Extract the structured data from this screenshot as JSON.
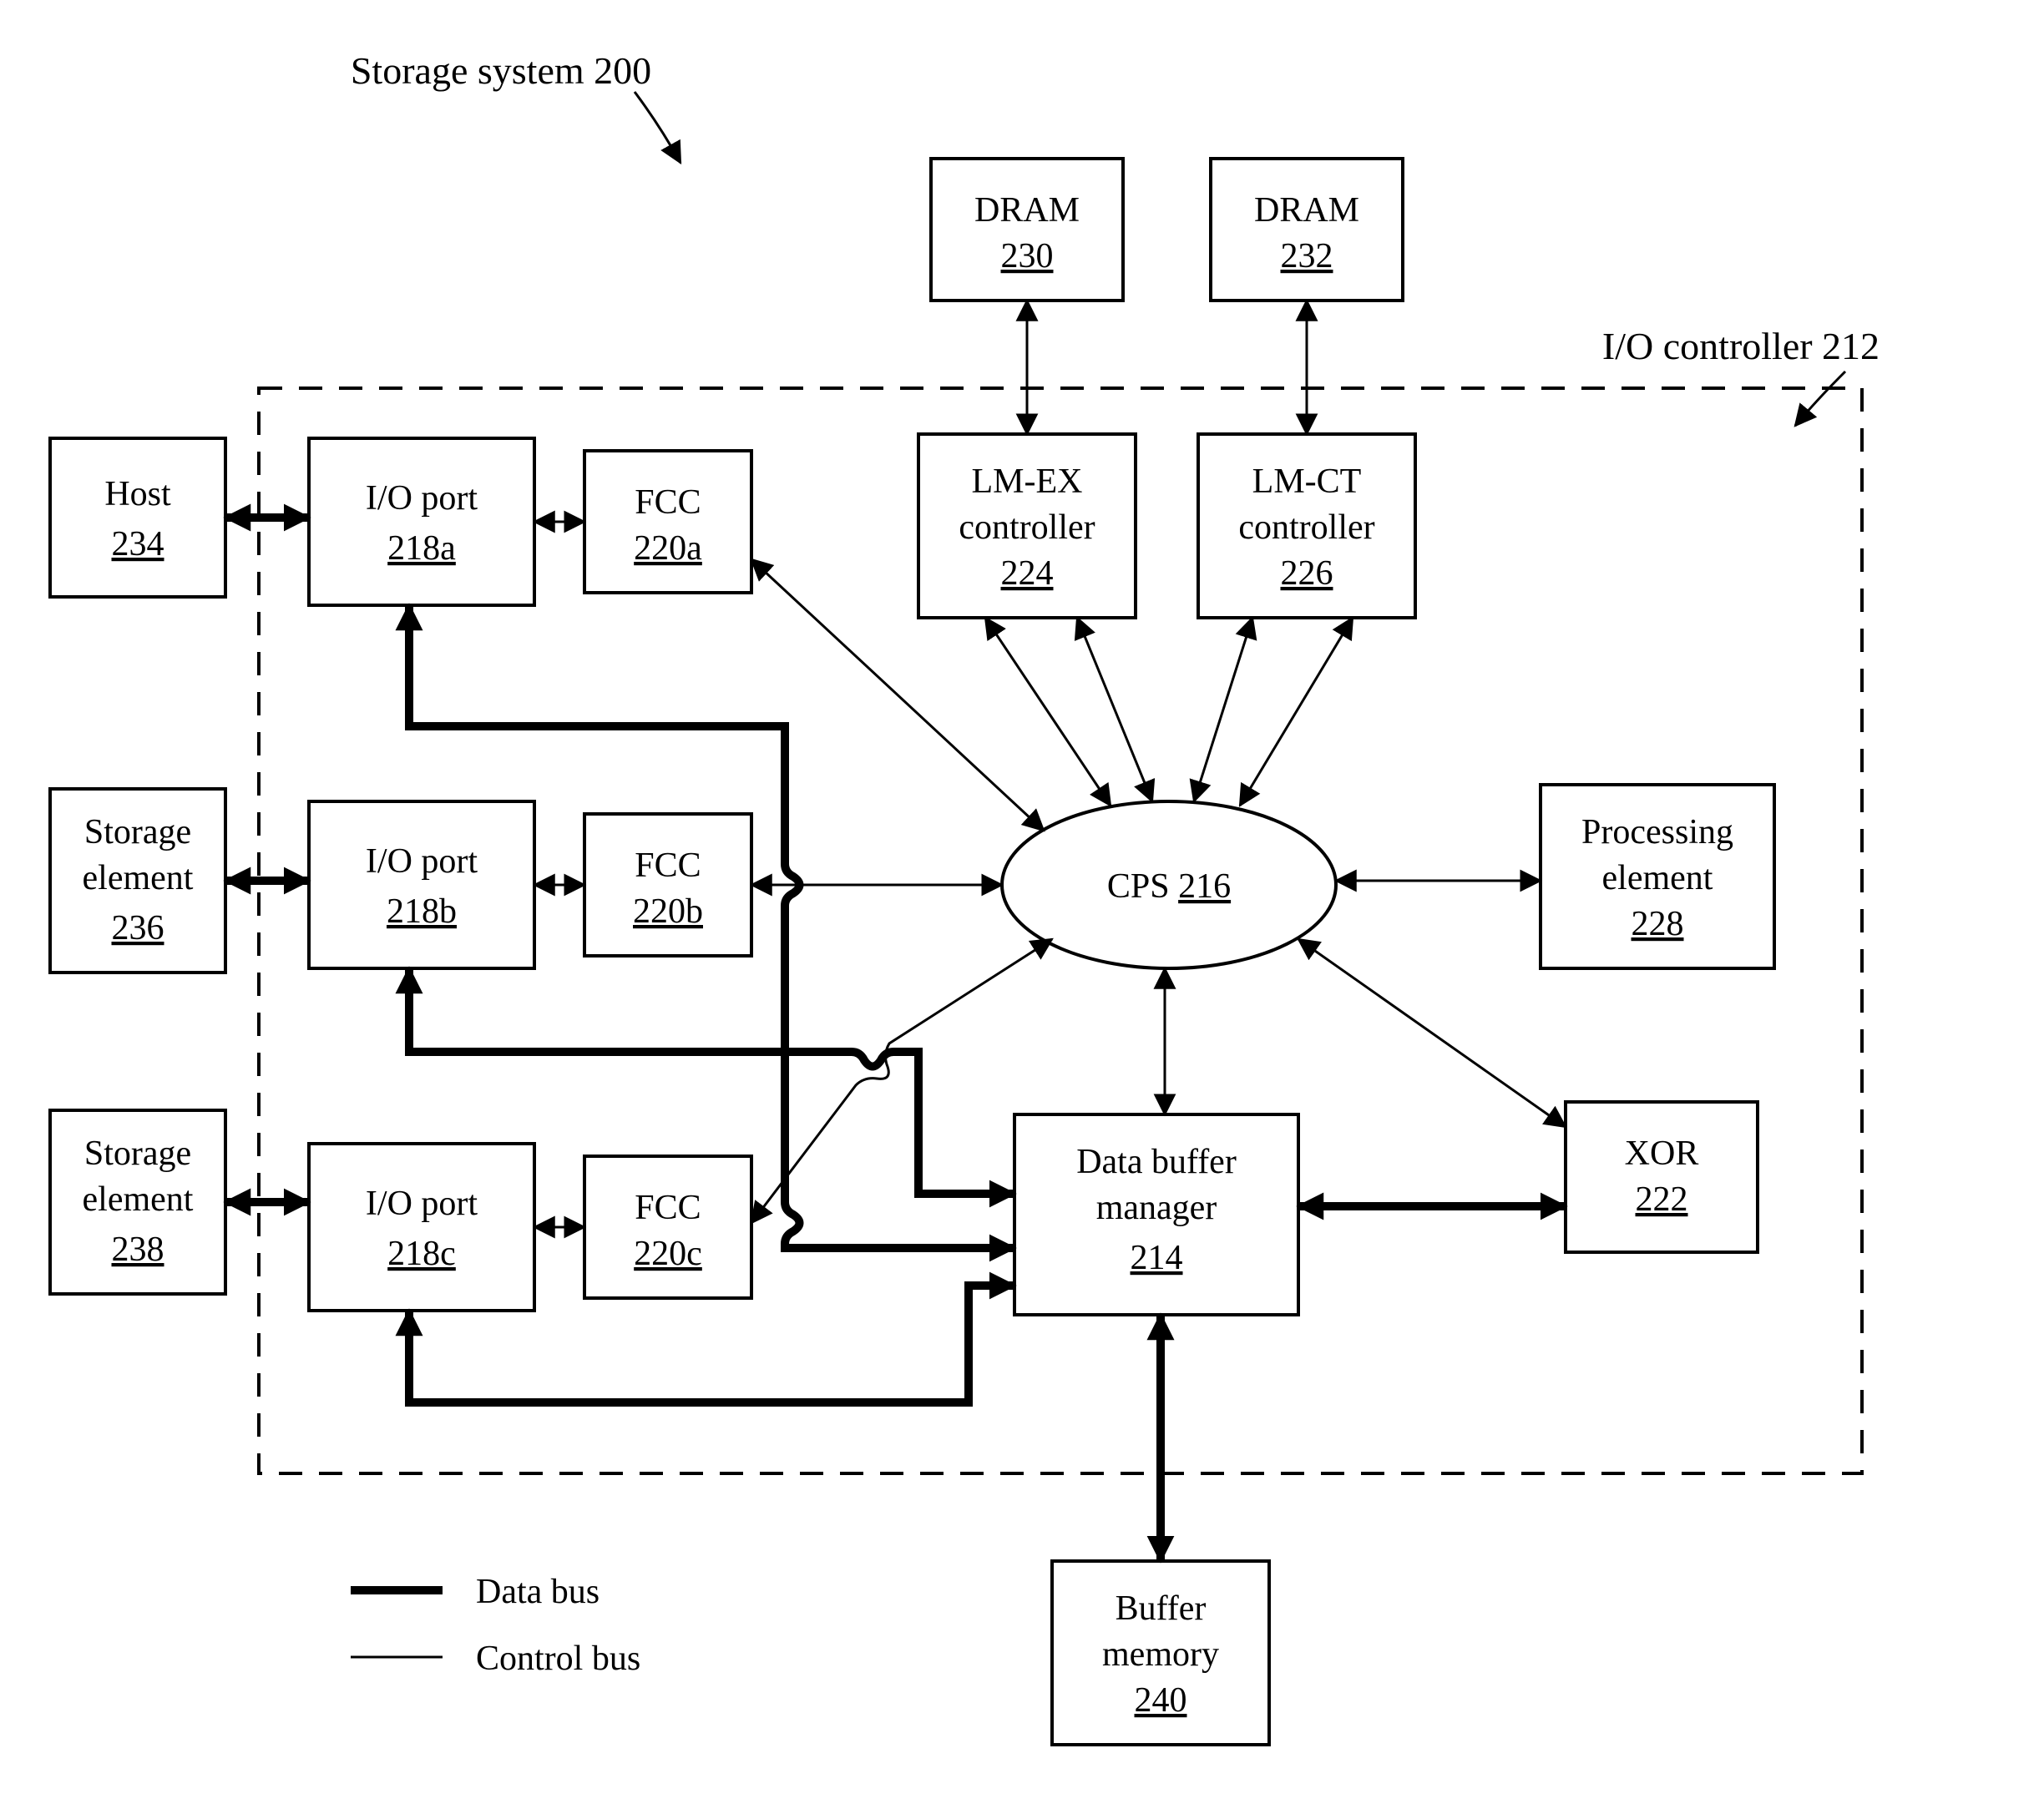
{
  "title": "Storage system 200",
  "controller_label": "I/O controller 212",
  "legend": {
    "data": "Data bus",
    "control": "Control bus"
  },
  "nodes": {
    "host": {
      "l1": "Host",
      "ref": "234"
    },
    "se1": {
      "l1": "Storage",
      "l2": "element",
      "ref": "236"
    },
    "se2": {
      "l1": "Storage",
      "l2": "element",
      "ref": "238"
    },
    "iop_a": {
      "l1": "I/O port",
      "ref": "218a"
    },
    "iop_b": {
      "l1": "I/O port",
      "ref": "218b"
    },
    "iop_c": {
      "l1": "I/O port",
      "ref": "218c"
    },
    "fcc_a": {
      "l1": "FCC",
      "ref": "220a"
    },
    "fcc_b": {
      "l1": "FCC",
      "ref": "220b"
    },
    "fcc_c": {
      "l1": "FCC",
      "ref": "220c"
    },
    "dram1": {
      "l1": "DRAM",
      "ref": "230"
    },
    "dram2": {
      "l1": "DRAM",
      "ref": "232"
    },
    "lmex": {
      "l1": "LM-EX",
      "l2": "controller",
      "ref": "224"
    },
    "lmct": {
      "l1": "LM-CT",
      "l2": "controller",
      "ref": "226"
    },
    "cps": {
      "l1": "CPS",
      "ref": "216"
    },
    "proc": {
      "l1": "Processing",
      "l2": "element",
      "ref": "228"
    },
    "xor": {
      "l1": "XOR",
      "ref": "222"
    },
    "dbm": {
      "l1": "Data buffer",
      "l2": "manager",
      "ref": "214"
    },
    "buf": {
      "l1": "Buffer",
      "l2": "memory",
      "ref": "240"
    }
  }
}
